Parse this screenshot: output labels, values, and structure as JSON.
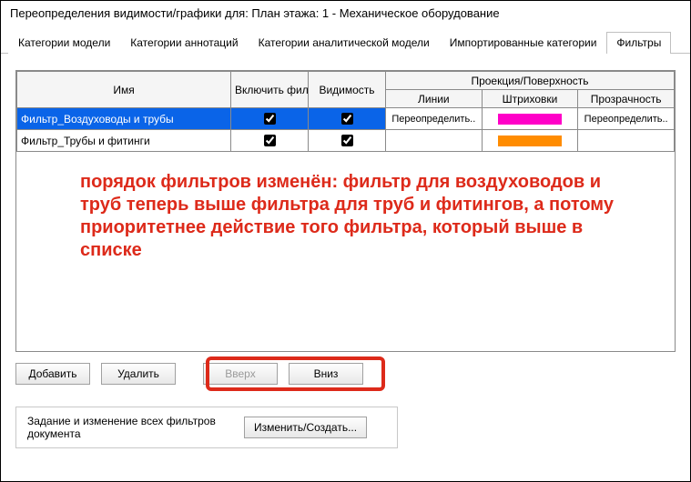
{
  "window_title": "Переопределения видимости/графики для: План этажа: 1 - Механическое оборудование",
  "tabs": {
    "model": "Категории модели",
    "annotation": "Категории аннотаций",
    "analytical": "Категории аналитической модели",
    "imported": "Импортированные категории",
    "filters": "Фильтры"
  },
  "headers": {
    "name": "Имя",
    "enable_filter": "Включить фильтр",
    "visibility": "Видимость",
    "projection_group": "Проекция/Поверхность",
    "lines": "Линии",
    "hatches": "Штриховки",
    "transparency": "Прозрачность"
  },
  "rows": [
    {
      "name": "Фильтр_Воздуховоды и трубы",
      "enable": true,
      "visibility": true,
      "lines": "Переопределить..",
      "hatch_color": "#ff00c8",
      "transparency": "Переопределить.."
    },
    {
      "name": "Фильтр_Трубы и фитинги",
      "enable": true,
      "visibility": true,
      "lines": "",
      "hatch_color": "#ff8c00",
      "transparency": ""
    }
  ],
  "annotation_text": "порядок фильтров изменён: фильтр для воздуховодов и труб теперь выше фильтра для труб и фитингов, а потому приоритетнее действие того фильтра, который выше в списке",
  "buttons": {
    "add": "Добавить",
    "remove": "Удалить",
    "up": "Вверх",
    "down": "Вниз"
  },
  "footer": {
    "text": "Задание и изменение всех фильтров документа",
    "edit": "Изменить/Создать..."
  }
}
